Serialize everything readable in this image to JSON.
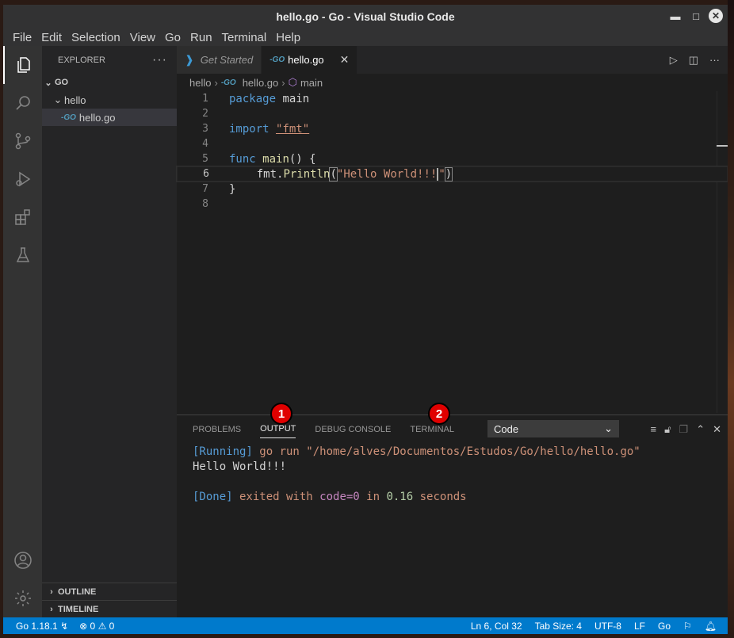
{
  "window": {
    "title": "hello.go - Go - Visual Studio Code"
  },
  "menu": [
    "File",
    "Edit",
    "Selection",
    "View",
    "Go",
    "Run",
    "Terminal",
    "Help"
  ],
  "sidebar": {
    "header": "EXPLORER",
    "root": "GO",
    "folder": "hello",
    "file": "hello.go",
    "outline": "OUTLINE",
    "timeline": "TIMELINE"
  },
  "tabs": [
    {
      "label": "Get Started"
    },
    {
      "label": "hello.go"
    }
  ],
  "breadcrumb": [
    "hello",
    "hello.go",
    "main"
  ],
  "editor": {
    "line_numbers": [
      "1",
      "2",
      "3",
      "4",
      "5",
      "6",
      "7",
      "8"
    ],
    "current_line": 6,
    "lines": {
      "l1_kw": "package",
      "l1_rest": " main",
      "l3_kw": "import",
      "l3_str": "\"fmt\"",
      "l5_kw": "func",
      "l5_fn": "main",
      "l5_rest": "() {",
      "l6_pre": "    fmt.",
      "l6_fn": "Println",
      "l6_open": "(",
      "l6_str": "\"Hello World!!!",
      "l6_strend": "\"",
      "l6_close": ")",
      "l7": "}"
    }
  },
  "panel": {
    "tabs": [
      "PROBLEMS",
      "OUTPUT",
      "DEBUG CONSOLE",
      "TERMINAL"
    ],
    "active_tab": "OUTPUT",
    "badges": [
      "1",
      "2"
    ],
    "select_value": "Code",
    "output": {
      "running_tag": "[Running]",
      "running_cmd": " go run \"/home/alves/Documentos/Estudos/Go/hello/hello.go\"",
      "hello": "Hello World!!!",
      "done_tag": "[Done]",
      "done_exited": " exited with ",
      "done_code": "code=0",
      "done_in": " in ",
      "done_time": "0.16",
      "done_seconds": " seconds"
    }
  },
  "status": {
    "go_version": "Go 1.18.1",
    "errors": "0",
    "warnings": "0",
    "position": "Ln 6, Col 32",
    "tab_size": "Tab Size: 4",
    "encoding": "UTF-8",
    "eol": "LF",
    "language": "Go"
  }
}
